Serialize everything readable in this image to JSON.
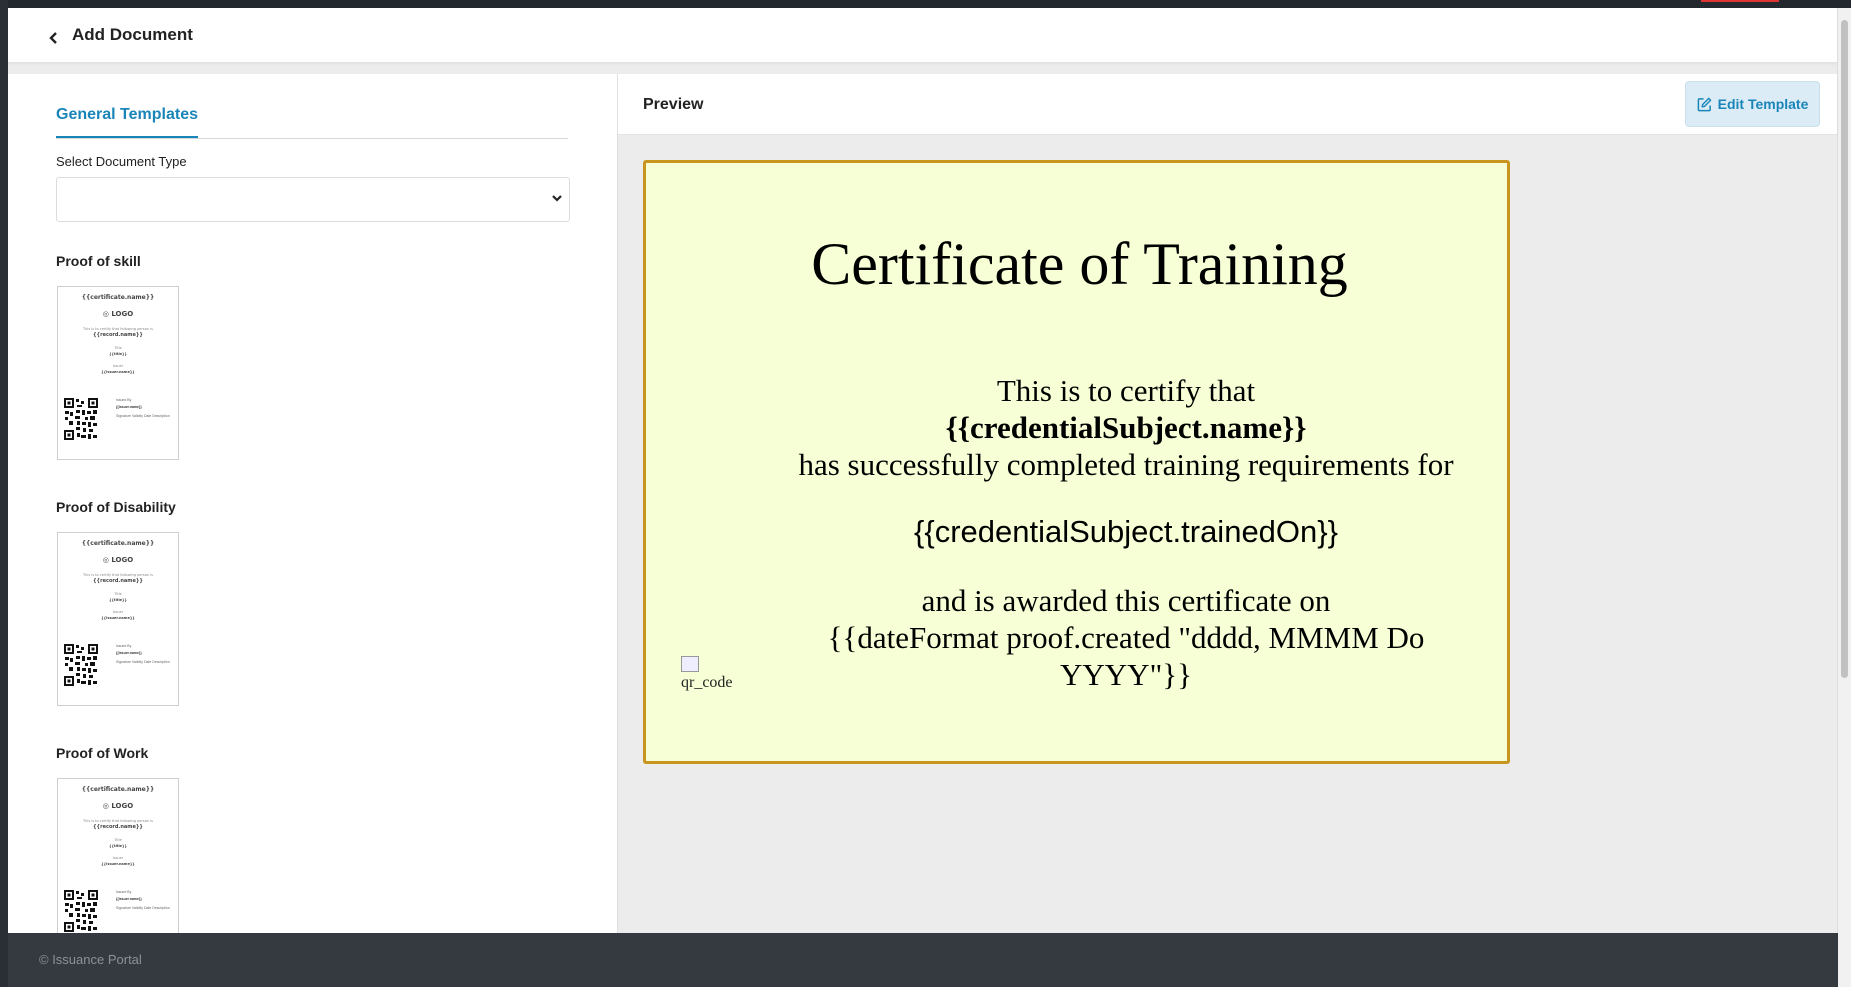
{
  "header": {
    "title": "Add Document"
  },
  "left": {
    "tab_label": "General Templates",
    "select_label": "Select Document Type",
    "select_value": "",
    "templates": [
      {
        "label": "Proof of skill"
      },
      {
        "label": "Proof of Disability"
      },
      {
        "label": "Proof of Work"
      }
    ],
    "thumbnail": {
      "title": "{{certificate.name}}",
      "logo": "LOGO",
      "intro": "This is to certify that following person is",
      "record": "{{record.name}}",
      "field1_label": "Title",
      "field1_value": "{{title}}",
      "field2_label": "Issuer",
      "field2_value": "{{issuer.name}}",
      "side_label": "Issued By",
      "side_value": "{{issuer.name}}",
      "side_sig": "Signature   Validity   Date  Description"
    }
  },
  "preview": {
    "title": "Preview",
    "edit_button": "Edit Template",
    "certificate": {
      "heading": "Certificate of Training",
      "line1": "This is to certify that",
      "line2": "{{credentialSubject.name}}",
      "line3": "has successfully completed training requirements for",
      "line4": "{{credentialSubject.trainedOn}}",
      "line5": "and is awarded this certificate on",
      "line6": "{{dateFormat proof.created \"dddd, MMMM Do YYYY\"}}",
      "qr_alt": "qr_code"
    }
  },
  "footer": {
    "copyright": "© Issuance Portal"
  },
  "colors": {
    "accent": "#1a85b8",
    "certificate_bg": "#f7ffd6",
    "certificate_border": "#c8961e",
    "footer_bg": "#343a40"
  }
}
